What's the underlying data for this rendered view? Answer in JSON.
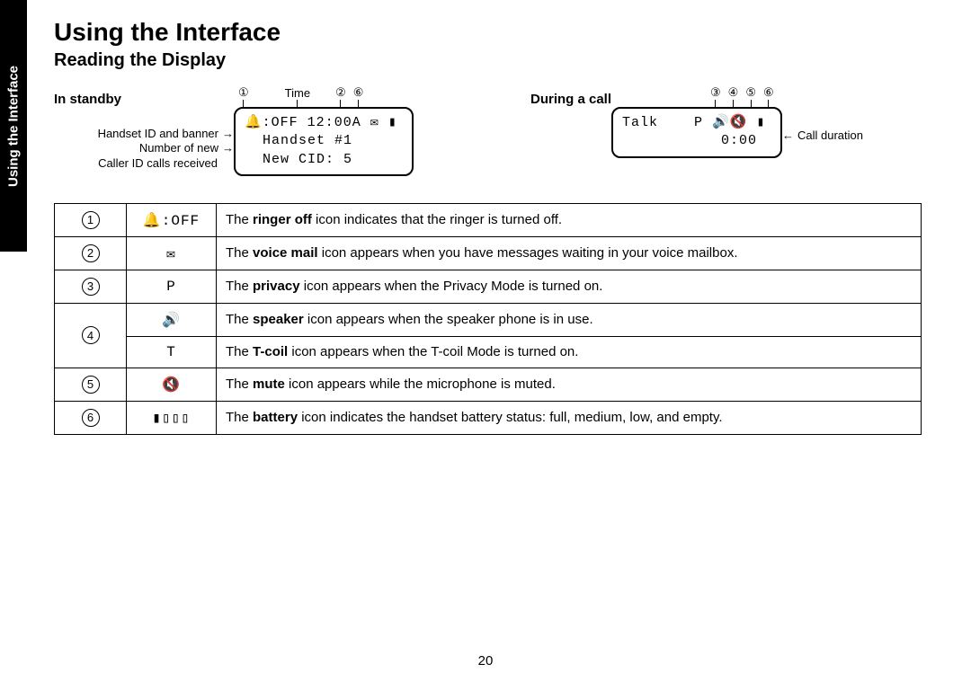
{
  "sideTab": "Using the Interface",
  "h1": "Using the Interface",
  "h2": "Reading the Display",
  "standby": {
    "title": "In standby",
    "timeLabel": "Time",
    "markers": {
      "one": "①",
      "two": "②",
      "six": "⑥"
    },
    "lcd": {
      "line1": "🔔:OFF 12:00A ✉ ▮",
      "line2": "  Handset #1",
      "line3": "  New CID: 5"
    },
    "annot": {
      "banner": "Handset ID and banner",
      "cid1": "Number of new",
      "cid2": "Caller ID calls received"
    }
  },
  "call": {
    "title": "During a call",
    "markers": {
      "three": "③",
      "four": "④",
      "five": "⑤",
      "six": "⑥"
    },
    "lcd": {
      "line1": "Talk    P 🔊🔇 ▮",
      "line2": "           0:00"
    },
    "annot": {
      "duration": "Call duration"
    }
  },
  "table": {
    "rows": [
      {
        "num": "①",
        "icon": "🔔:OFF",
        "bold": "ringer off",
        "rest_a": "The ",
        "rest_b": " icon indicates that the ringer is turned off."
      },
      {
        "num": "②",
        "icon": "✉",
        "bold": "voice mail",
        "rest_a": "The ",
        "rest_b": " icon appears when you have messages waiting in your voice mailbox."
      },
      {
        "num": "③",
        "icon": "P",
        "bold": "privacy",
        "rest_a": "The ",
        "rest_b": " icon appears when the Privacy Mode is turned on."
      },
      {
        "num": "④a",
        "icon": "🔊",
        "bold": "speaker",
        "rest_a": "The ",
        "rest_b": " icon appears when the speaker phone is in use."
      },
      {
        "num": "④b",
        "icon": "T",
        "bold": "T-coil",
        "rest_a": "The ",
        "rest_b": " icon appears when the T-coil Mode is turned on."
      },
      {
        "num": "⑤",
        "icon": "🔇",
        "bold": "mute",
        "rest_a": "The ",
        "rest_b": " icon appears while the microphone is muted."
      },
      {
        "num": "⑥",
        "icon": "▮▯▯▯",
        "bold": "battery",
        "rest_a": "The ",
        "rest_b": " icon indicates the handset battery status: full, medium, low, and empty."
      }
    ],
    "num4": "④"
  },
  "pageNumber": "20"
}
